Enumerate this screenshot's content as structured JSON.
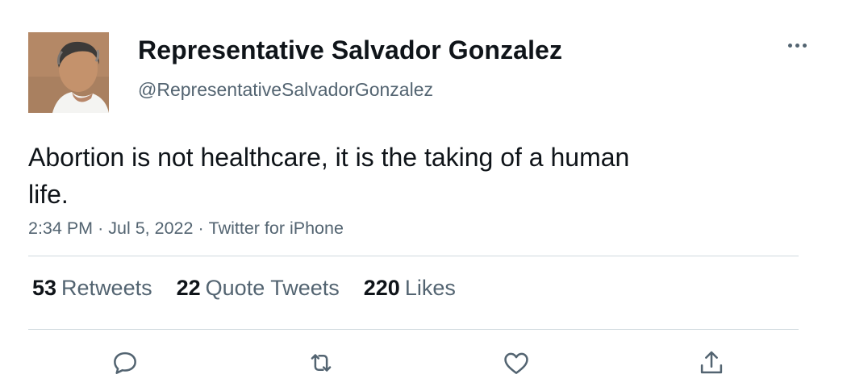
{
  "user": {
    "display_name": "Representative Salvador Gonzalez",
    "handle": "@RepresentativeSalvadorGonzalez",
    "avatar_icon": "profile-photo"
  },
  "tweet": {
    "text": "Abortion is not healthcare, it is the taking of a human life.",
    "time": "2:34 PM",
    "date": "Jul 5, 2022",
    "source": "Twitter for iPhone",
    "separator": "·"
  },
  "stats": {
    "retweets": {
      "count": "53",
      "label": "Retweets"
    },
    "quotes": {
      "count": "22",
      "label": "Quote Tweets"
    },
    "likes": {
      "count": "220",
      "label": "Likes"
    }
  },
  "actions": {
    "reply_icon": "reply-icon",
    "retweet_icon": "retweet-icon",
    "like_icon": "like-icon",
    "share_icon": "share-icon",
    "more_icon": "more-icon"
  },
  "colors": {
    "text_primary": "#0f1419",
    "text_secondary": "#536471",
    "divider": "#cfd9de"
  }
}
